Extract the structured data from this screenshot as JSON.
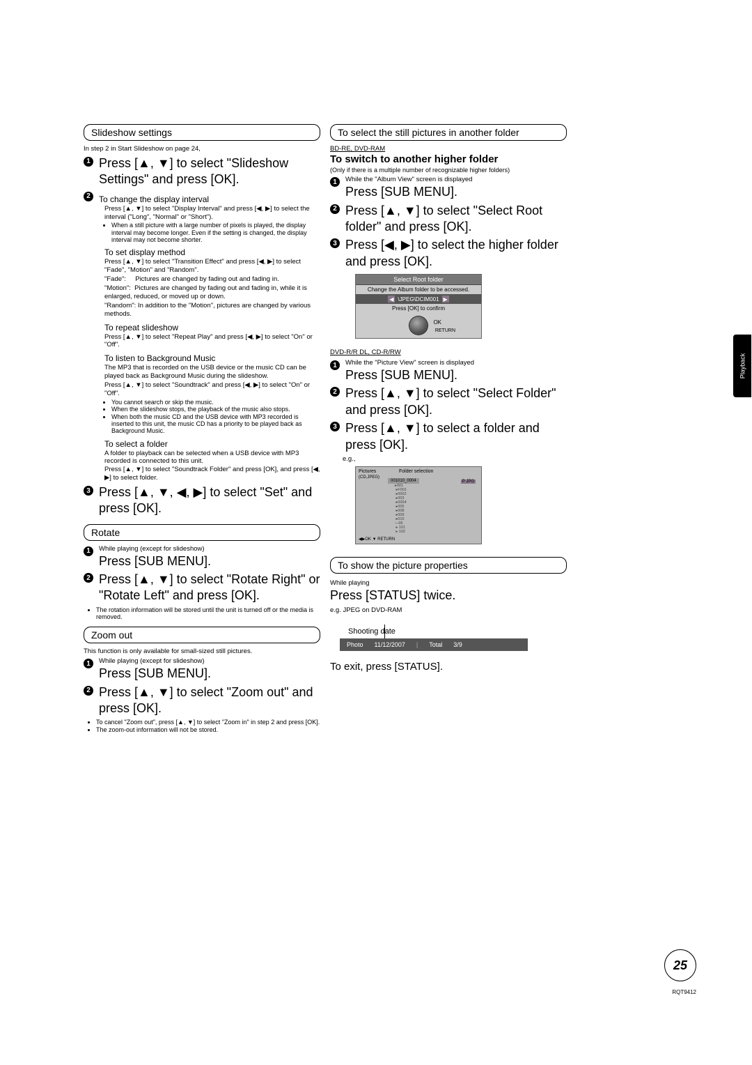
{
  "left": {
    "slideshow_header": "Slideshow settings",
    "in_step": "In step 2 in Start Slideshow on page 24,",
    "step1": "Press [▲, ▼] to select \"Slideshow Settings\" and press [OK].",
    "change_interval_h": "To change the display interval",
    "change_interval_b": "Press [▲, ▼] to select \"Display Interval\" and press [◀, ▶] to select the interval (\"Long\", \"Normal\" or \"Short\").",
    "change_interval_note": "When a still picture with a large number of pixels is played, the display interval may become longer. Even if the setting is changed, the display interval may not become shorter.",
    "set_display_h": "To set display method",
    "set_display_b": "Press [▲, ▼] to select \"Transition Effect\" and press [◀, ▶] to select \"Fade\", \"Motion\" and \"Random\".",
    "set_fade": "\"Fade\":     Pictures are changed by fading out and fading in.",
    "set_motion": "\"Motion\":  Pictures are changed by fading out and fading in, while it is enlarged, reduced, or moved up or down.",
    "set_random": "\"Random\": In addition to the \"Motion\", pictures are changed by various methods.",
    "repeat_h": "To repeat slideshow",
    "repeat_b": "Press [▲, ▼] to select \"Repeat Play\" and press [◀, ▶] to select \"On\" or \"Off\".",
    "bg_h": "To listen to Background Music",
    "bg_b1": "The MP3 that is recorded on the USB device or the music CD can be played back as Background Music during the slideshow.",
    "bg_b2": "Press [▲, ▼] to select \"Soundtrack\" and press [◀, ▶] to select \"On\" or \"Off\".",
    "bg_li1": "You cannot search or skip the music.",
    "bg_li2": "When the slideshow stops, the playback of the music also stops.",
    "bg_li3": "When both the music CD and the USB device with MP3 recorded is inserted to this unit, the music CD has a priority to be played back as Background Music.",
    "selfolder_h": "To select a folder",
    "selfolder_b": "A folder to playback can be selected when a USB device with MP3 recorded is connected to this unit.\nPress [▲, ▼] to select \"Soundtrack Folder\" and press [OK], and press [◀, ▶] to select folder.",
    "step3": "Press [▲, ▼, ◀, ▶] to select \"Set\" and press [OK].",
    "rotate_header": "Rotate",
    "rotate_s1_a": "While playing (except for slideshow)",
    "rotate_s1_b": "Press [SUB MENU].",
    "rotate_s2": "Press [▲, ▼] to select \"Rotate Right\" or \"Rotate Left\" and press [OK].",
    "rotate_note": "The rotation information will be stored until the unit is turned off or the media is removed.",
    "zoom_header": "Zoom out",
    "zoom_intro": "This function is only available for small-sized still pictures.",
    "zoom_s1_a": "While playing (except for slideshow)",
    "zoom_s1_b": "Press [SUB MENU].",
    "zoom_s2": "Press [▲, ▼] to select \"Zoom out\" and press [OK].",
    "zoom_n1": "To cancel \"Zoom out\", press [▲, ▼] to select \"Zoom in\" in step 2 and press [OK].",
    "zoom_n2": "The zoom-out information will not be stored."
  },
  "right": {
    "header1": "To select the still pictures in another folder",
    "disc1": "BD-RE, DVD-RAM",
    "switch_h": "To switch to another higher folder",
    "switch_note": "(Only if there is a multiple number of recognizable higher folders)",
    "r1_s1_a": "While the \"Album View\" screen is displayed",
    "r1_s1_b": "Press [SUB MENU].",
    "r1_s2": "Press [▲, ▼] to select \"Select Root folder\" and press [OK].",
    "r1_s3": "Press [◀, ▶] to select the higher folder and press [OK].",
    "osd1_title": "Select Root folder",
    "osd1_line": "Change the Album folder to be accessed.",
    "osd1_path": "\\JPEG\\DCIM001",
    "osd1_ok": "Press [OK] to confirm",
    "disc2": "DVD-R/R DL, CD-R/RW",
    "r2_s1_a": "While the \"Picture View\" screen is displayed",
    "r2_s1_b": "Press [SUB MENU].",
    "r2_s2": "Press [▲, ▼] to select \"Select Folder\" and press [OK].",
    "r2_s3": "Press [▲, ▼] to select a folder and press [OK].",
    "eg": "e.g.,",
    "osd2_title": "Pictures",
    "osd2_sub": "(CD,JPEG)",
    "osd2_lbl": "Folder selection",
    "osd2_cursor": "001010_0004",
    "osd2_badge": "P JPG",
    "osd2_tree": "▸001\n ▸F001\n ▸0002\n ▸003\n ▸0004\n ▸005\n ▸008\n ▸009\n ▸010\n—05\n ▸ 101\n ▸ 102",
    "osd2_foot": "◀▶OK  ▼\nRETURN",
    "header2": "To show the picture properties",
    "props_while": "While playing",
    "props_status": "Press [STATUS] twice.",
    "props_eg": "e.g. JPEG on DVD-RAM",
    "props_shoot": "Shooting date",
    "sb_photo": "Photo",
    "sb_date": "11/12/2007",
    "sb_total": "Total",
    "sb_frac": "3/9",
    "props_exit": "To exit, press [STATUS]."
  },
  "side_tab": "Playback",
  "page_number": "25",
  "rqt": "RQT9412"
}
